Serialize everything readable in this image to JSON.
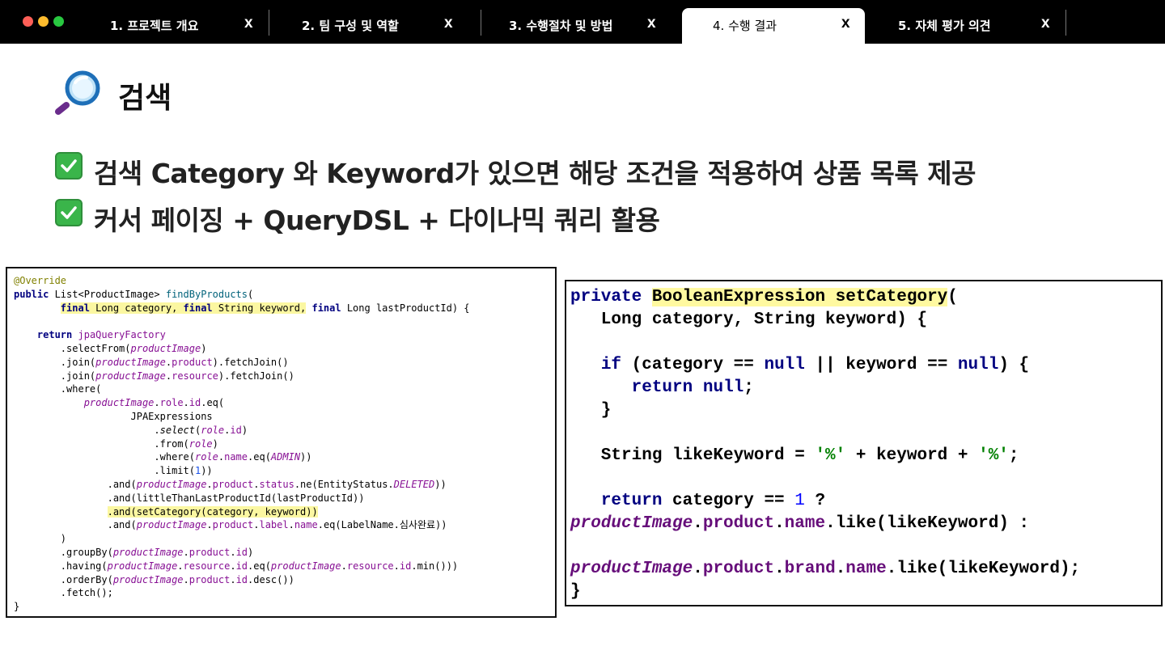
{
  "tabs": [
    {
      "label": "1. 프로젝트 개요",
      "close": "x"
    },
    {
      "label": "2. 팀 구성 및 역할",
      "close": "x"
    },
    {
      "label": "3. 수행절차 및 방법",
      "close": "x"
    },
    {
      "label": "4. 수행 결과",
      "close": "x"
    },
    {
      "label": "5. 자체 평가 의견",
      "close": "x"
    }
  ],
  "active_tab": "4. 수행 결과",
  "page": {
    "title": "검색",
    "bullets": [
      "검색 Category 와 Keyword가 있으면 해당 조건을 적용하여 상품 목록 제공",
      "커서 페이징 + QueryDSL + 다이나믹 쿼리 활용"
    ]
  },
  "code_left": {
    "lines": [
      "@Override",
      "public List<ProductImage> findByProducts(",
      "        final Long category, final String keyword, final Long lastProductId) {",
      "",
      "    return jpaQueryFactory",
      "        .selectFrom(productImage)",
      "        .join(productImage.product).fetchJoin()",
      "        .join(productImage.resource).fetchJoin()",
      "        .where(",
      "            productImage.role.id.eq(",
      "                    JPAExpressions",
      "                        .select(role.id)",
      "                        .from(role)",
      "                        .where(role.name.eq(ADMIN))",
      "                        .limit(1))",
      "                .and(productImage.product.status.ne(EntityStatus.DELETED))",
      "                .and(littleThanLastProductId(lastProductId))",
      "                .and(setCategory(category, keyword))",
      "                .and(productImage.product.label.name.eq(LabelName.심사완료))",
      "        )",
      "        .groupBy(productImage.product.id)",
      "        .having(productImage.resource.id.eq(productImage.resource.id.min()))",
      "        .orderBy(productImage.product.id.desc())",
      "        .fetch();",
      "}"
    ]
  },
  "code_right": {
    "lines": [
      "private BooleanExpression setCategory(",
      "   Long category, String keyword) {",
      "",
      "   if (category == null || keyword == null) {",
      "      return null;",
      "   }",
      "",
      "   String likeKeyword = '%' + keyword + '%';",
      "",
      "   return category == 1 ?",
      "productImage.product.name.like(likeKeyword) :",
      "",
      "productImage.product.brand.name.like(likeKeyword);",
      "}"
    ]
  },
  "colors": {
    "tabbar": "#000000",
    "keyword": "#000080",
    "field": "#871094",
    "highlight": "#fbf7a1",
    "check": "#3ab54a"
  },
  "icons": [
    "magnifying-glass-icon",
    "check-box-icon",
    "close-icon"
  ]
}
